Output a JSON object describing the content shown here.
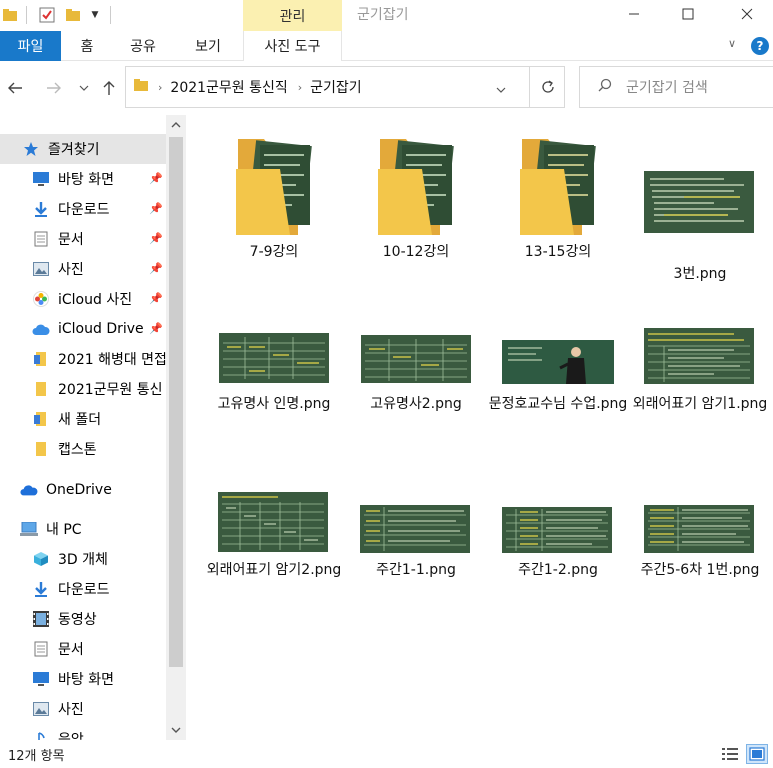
{
  "window": {
    "title": "군기잡기",
    "context_tab_group": "관리"
  },
  "ribbon": {
    "tabs": [
      "파일",
      "홈",
      "공유",
      "보기",
      "사진 도구"
    ]
  },
  "address": {
    "crumbs": [
      "2021군무원 통신직",
      "군기잡기"
    ],
    "search_placeholder": "군기잡기 검색"
  },
  "navpane": {
    "items": [
      {
        "label": "즐겨찾기",
        "icon": "star-icon"
      },
      {
        "label": "바탕 화면",
        "icon": "desktop-icon"
      },
      {
        "label": "다운로드",
        "icon": "download-icon"
      },
      {
        "label": "문서",
        "icon": "document-icon"
      },
      {
        "label": "사진",
        "icon": "pictures-icon"
      },
      {
        "label": "iCloud 사진",
        "icon": "icloud-photos-icon"
      },
      {
        "label": "iCloud Drive",
        "icon": "icloud-drive-icon"
      },
      {
        "label": "2021 해병대 면접",
        "icon": "folder-icon"
      },
      {
        "label": "2021군무원 통신",
        "icon": "folder-icon"
      },
      {
        "label": "새 폴더",
        "icon": "folder-icon"
      },
      {
        "label": "캡스톤",
        "icon": "folder-icon"
      },
      {
        "label": "OneDrive",
        "icon": "onedrive-icon"
      },
      {
        "label": "내 PC",
        "icon": "pc-icon"
      },
      {
        "label": "3D 개체",
        "icon": "3d-objects-icon"
      },
      {
        "label": "다운로드",
        "icon": "download-icon"
      },
      {
        "label": "동영상",
        "icon": "video-icon"
      },
      {
        "label": "문서",
        "icon": "document-icon"
      },
      {
        "label": "바탕 화면",
        "icon": "desktop-icon"
      },
      {
        "label": "사진",
        "icon": "pictures-icon"
      },
      {
        "label": "음악",
        "icon": "music-icon"
      }
    ]
  },
  "files": [
    {
      "name": "7-9강의",
      "kind": "folder"
    },
    {
      "name": "10-12강의",
      "kind": "folder"
    },
    {
      "name": "13-15강의",
      "kind": "folder"
    },
    {
      "name": "3번.png",
      "kind": "image"
    },
    {
      "name": "고유명사 인명.png",
      "kind": "image"
    },
    {
      "name": "고유명사2.png",
      "kind": "image"
    },
    {
      "name": "문정호교수님 수업.png",
      "kind": "image"
    },
    {
      "name": "외래어표기 암기1.png",
      "kind": "image"
    },
    {
      "name": "외래어표기 암기2.png",
      "kind": "image"
    },
    {
      "name": "주간1-1.png",
      "kind": "image"
    },
    {
      "name": "주간1-2.png",
      "kind": "image"
    },
    {
      "name": "주간5-6차 1번.png",
      "kind": "image"
    }
  ],
  "status": {
    "item_count": "12개 항목"
  },
  "colors": {
    "accent": "#1979ca",
    "context_tab": "#fbf0b1",
    "folder": "#f3c64a",
    "chalkboard": "#3a5a3f"
  }
}
